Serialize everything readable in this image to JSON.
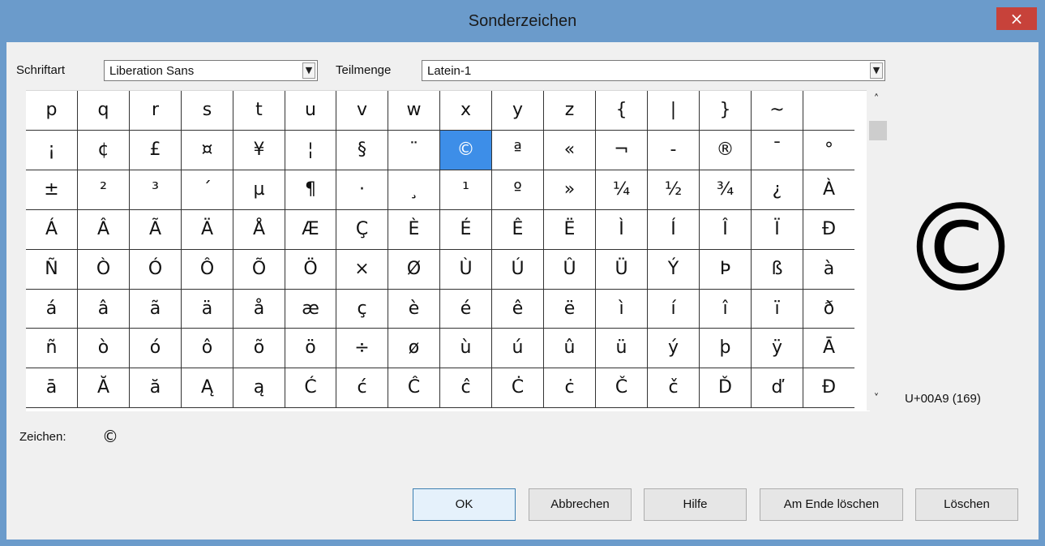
{
  "window": {
    "title": "Sonderzeichen",
    "close": "×"
  },
  "font": {
    "label": "Schriftart",
    "value": "Liberation Sans"
  },
  "subset": {
    "label": "Teilmenge",
    "value": "Latein-1"
  },
  "characters": [
    [
      "p",
      "q",
      "r",
      "s",
      "t",
      "u",
      "v",
      "w",
      "x",
      "y",
      "z",
      "{",
      "|",
      "}",
      "~",
      ""
    ],
    [
      "¡",
      "¢",
      "£",
      "¤",
      "¥",
      "¦",
      "§",
      "¨",
      "©",
      "ª",
      "«",
      "¬",
      "-",
      "®",
      "¯",
      "°"
    ],
    [
      "±",
      "²",
      "³",
      "´",
      "µ",
      "¶",
      "·",
      "¸",
      "¹",
      "º",
      "»",
      "¼",
      "½",
      "¾",
      "¿",
      "À"
    ],
    [
      "Á",
      "Â",
      "Ã",
      "Ä",
      "Å",
      "Æ",
      "Ç",
      "È",
      "É",
      "Ê",
      "Ë",
      "Ì",
      "Í",
      "Î",
      "Ï",
      "Ð"
    ],
    [
      "Ñ",
      "Ò",
      "Ó",
      "Ô",
      "Õ",
      "Ö",
      "×",
      "Ø",
      "Ù",
      "Ú",
      "Û",
      "Ü",
      "Ý",
      "Þ",
      "ß",
      "à"
    ],
    [
      "á",
      "â",
      "ã",
      "ä",
      "å",
      "æ",
      "ç",
      "è",
      "é",
      "ê",
      "ë",
      "ì",
      "í",
      "î",
      "ï",
      "ð"
    ],
    [
      "ñ",
      "ò",
      "ó",
      "ô",
      "õ",
      "ö",
      "÷",
      "ø",
      "ù",
      "ú",
      "û",
      "ü",
      "ý",
      "þ",
      "ÿ",
      "Ā"
    ],
    [
      "ā",
      "Ă",
      "ă",
      "Ą",
      "ą",
      "Ć",
      "ć",
      "Ĉ",
      "ĉ",
      "Ċ",
      "ċ",
      "Č",
      "č",
      "Ď",
      "ď",
      "Đ"
    ]
  ],
  "selected": {
    "row": 1,
    "col": 8
  },
  "preview": {
    "glyph": "©",
    "code": "U+00A9 (169)"
  },
  "zeichen": {
    "label": "Zeichen:",
    "value": "©"
  },
  "buttons": {
    "ok": "OK",
    "cancel": "Abbrechen",
    "help": "Hilfe",
    "delete_end": "Am Ende löschen",
    "delete": "Löschen"
  },
  "scroll": {
    "up": "˄",
    "down": "˅"
  },
  "colors": {
    "selection": "#3d8ee8",
    "close": "#c7423a",
    "frame": "#6b9bcb"
  }
}
